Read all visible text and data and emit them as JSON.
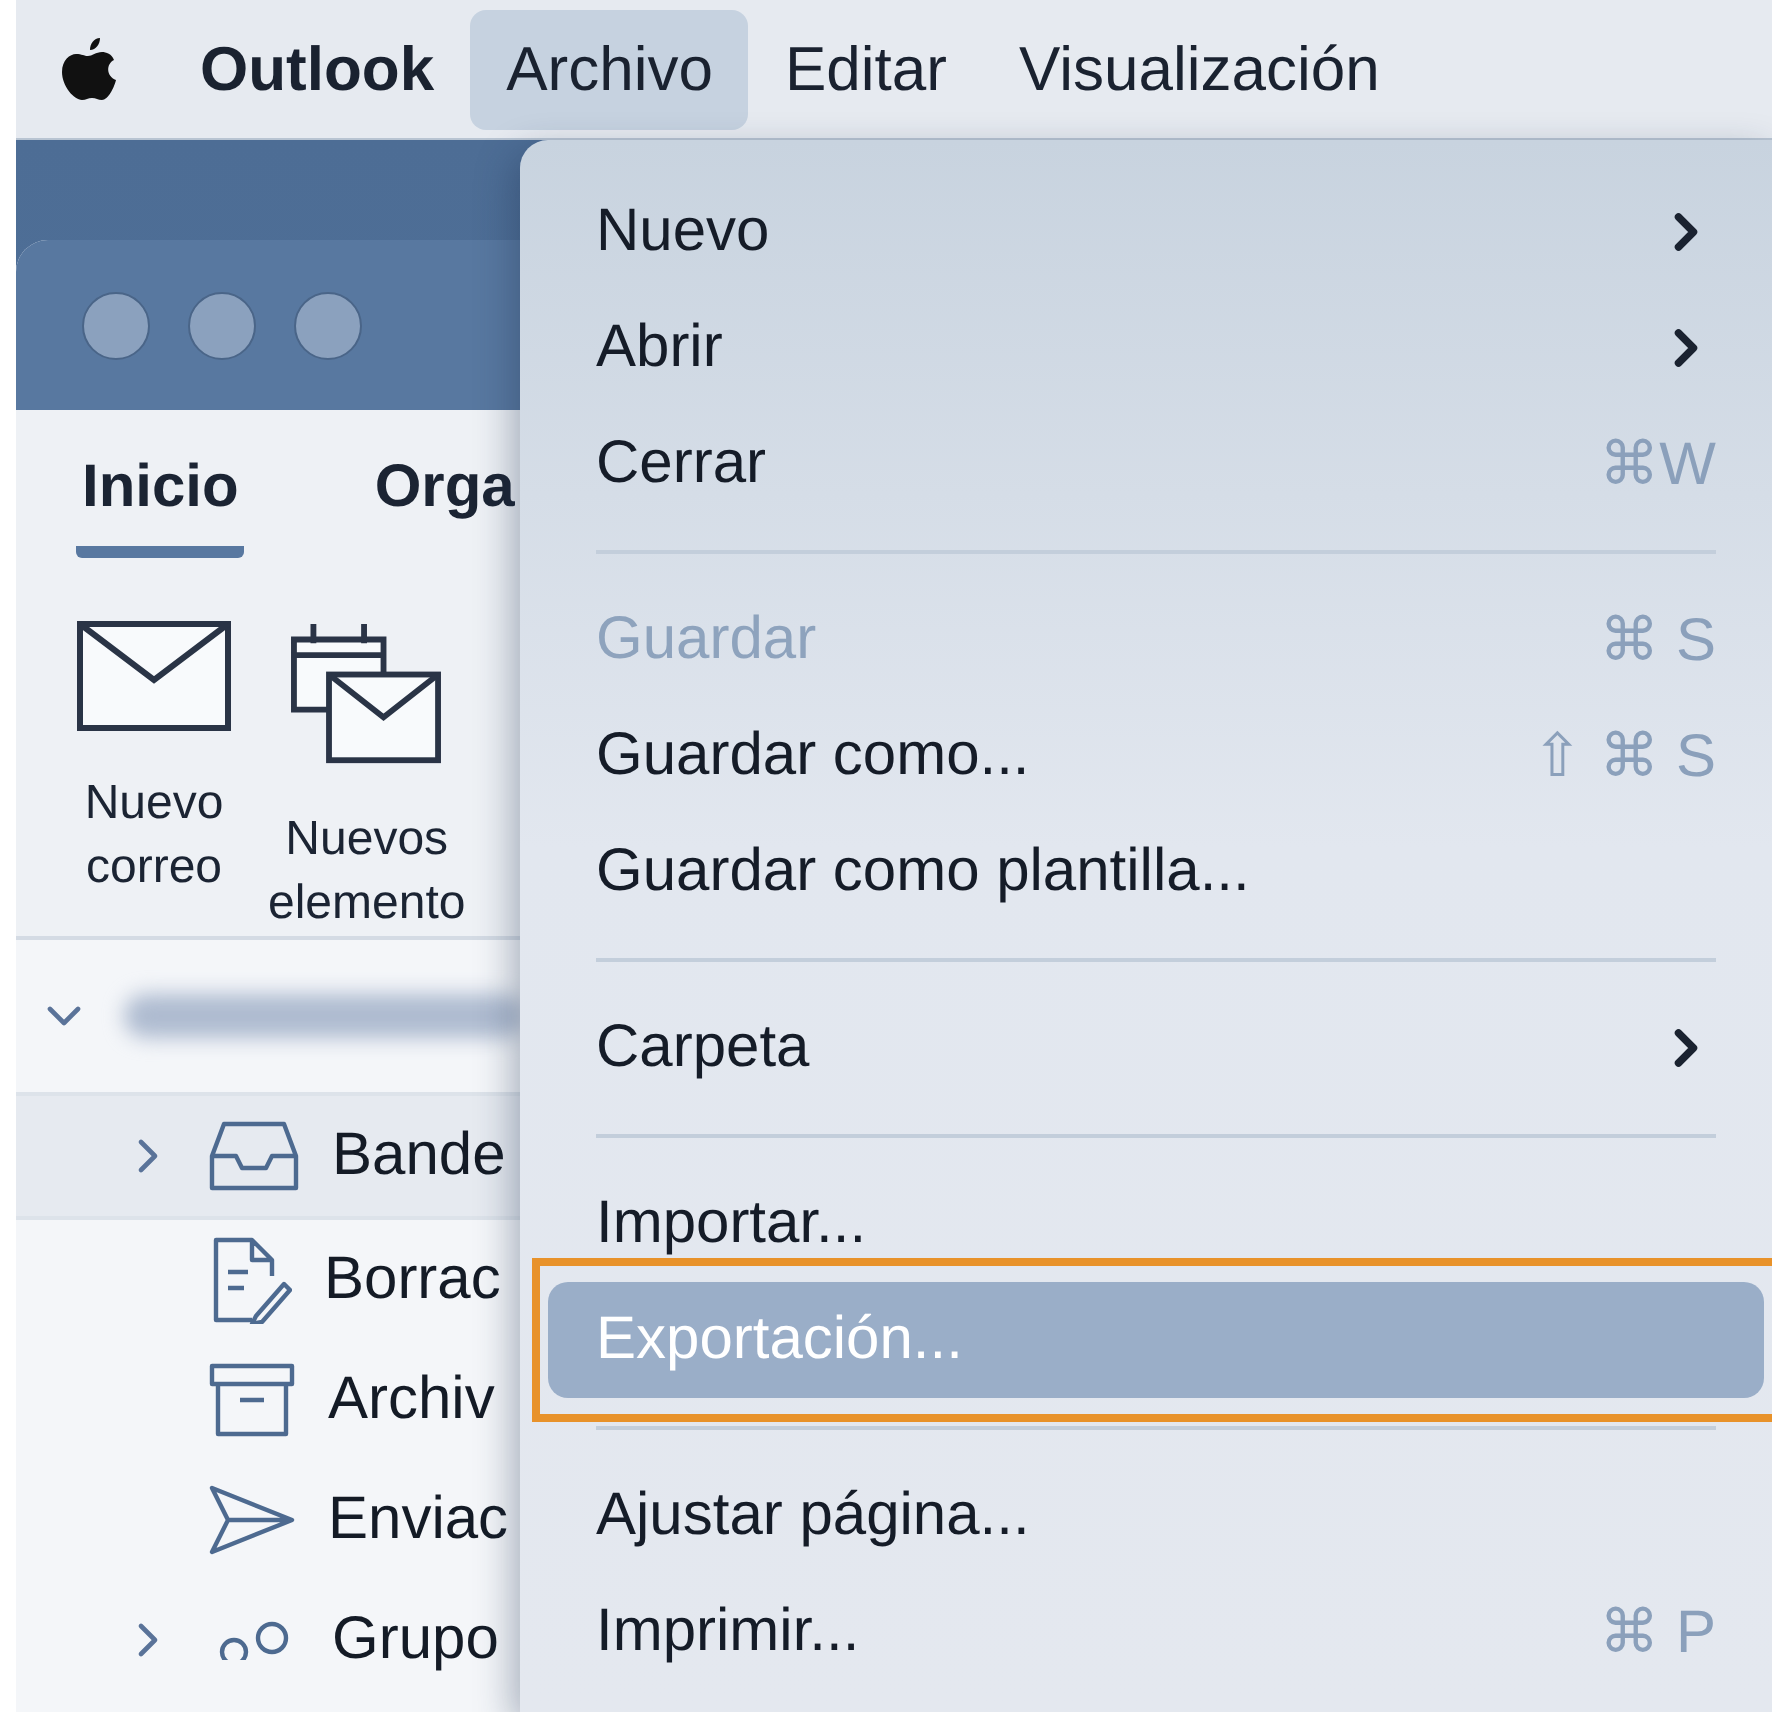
{
  "menu_bar": {
    "items": [
      {
        "label": "Outlook",
        "kind": "app",
        "selected": false
      },
      {
        "label": "Archivo",
        "kind": "menu",
        "selected": true
      },
      {
        "label": "Editar",
        "kind": "menu",
        "selected": false
      },
      {
        "label": "Visualización",
        "kind": "menu",
        "selected": false
      }
    ]
  },
  "window": {
    "tabs": [
      {
        "label": "Inicio",
        "selected": true
      },
      {
        "label": "Orga",
        "selected": false
      }
    ],
    "ribbon": [
      {
        "kind": "mail",
        "lines": [
          "Nuevo",
          "correo"
        ]
      },
      {
        "kind": "items",
        "lines": [
          "Nuevos",
          "elemento"
        ]
      }
    ],
    "account": {
      "expanded": true
    },
    "folders": [
      {
        "kind": "inbox",
        "label": "Bande",
        "expandable": true,
        "selected": true
      },
      {
        "kind": "drafts",
        "label": "Borrac",
        "expandable": false,
        "selected": false
      },
      {
        "kind": "archive",
        "label": "Archiv",
        "expandable": false,
        "selected": false
      },
      {
        "kind": "sent",
        "label": "Enviac",
        "expandable": false,
        "selected": false
      },
      {
        "kind": "group",
        "label": "Grupo",
        "expandable": true,
        "selected": false
      }
    ]
  },
  "file_menu": {
    "sections": [
      [
        {
          "label": "Nuevo",
          "submenu": true,
          "disabled": false,
          "selected": false,
          "framed": false
        },
        {
          "label": "Abrir",
          "submenu": true,
          "disabled": false,
          "selected": false,
          "framed": false
        },
        {
          "label": "Cerrar",
          "shortcut": "⌘W",
          "submenu": false,
          "disabled": false,
          "selected": false,
          "framed": false
        }
      ],
      [
        {
          "label": "Guardar",
          "shortcut": "⌘ S",
          "submenu": false,
          "disabled": true,
          "selected": false,
          "framed": false
        },
        {
          "label": "Guardar como...",
          "shortcut": "⇧ ⌘ S",
          "submenu": false,
          "disabled": false,
          "selected": false,
          "framed": false
        },
        {
          "label": "Guardar como plantilla...",
          "submenu": false,
          "disabled": false,
          "selected": false,
          "framed": false
        }
      ],
      [
        {
          "label": "Carpeta",
          "submenu": true,
          "disabled": false,
          "selected": false,
          "framed": false
        }
      ],
      [
        {
          "label": "Importar...",
          "submenu": false,
          "disabled": false,
          "selected": false,
          "framed": false
        },
        {
          "label": "Exportación...",
          "submenu": false,
          "disabled": false,
          "selected": true,
          "framed": true
        }
      ],
      [
        {
          "label": "Ajustar página...",
          "submenu": false,
          "disabled": false,
          "selected": false,
          "framed": false
        },
        {
          "label": "Imprimir...",
          "shortcut": "⌘ P",
          "submenu": false,
          "disabled": false,
          "selected": false,
          "framed": false
        }
      ]
    ]
  }
}
